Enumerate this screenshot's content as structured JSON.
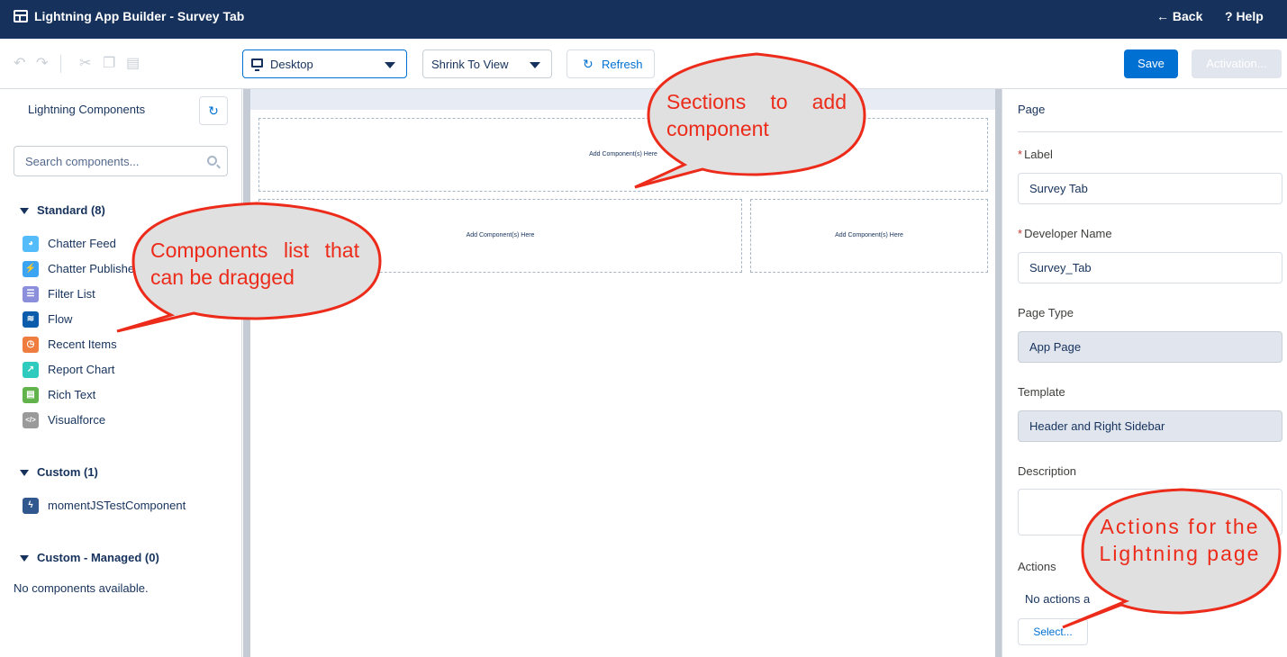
{
  "window": {
    "title": "Lightning App Builder - Survey Tab",
    "back_label": "← Back",
    "help_label": "? Help"
  },
  "toolbar": {
    "device_select": "Desktop",
    "view_select": "Shrink To View",
    "refresh_label": "Refresh",
    "save_label": "Save",
    "activation_label": "Activation..."
  },
  "left_panel": {
    "heading": "Lightning Components",
    "search_placeholder": "Search components...",
    "sections": [
      {
        "title": "Standard (8)",
        "items": [
          {
            "label": "Chatter Feed",
            "icon": "chatter-feed-icon",
            "color": "#55bcfc"
          },
          {
            "label": "Chatter Publisher",
            "icon": "lightning-bolt-icon",
            "color": "#3ba5f3"
          },
          {
            "label": "Filter List",
            "icon": "list-icon",
            "color": "#8b8edb"
          },
          {
            "label": "Flow",
            "icon": "flow-icon",
            "color": "#0b5cab"
          },
          {
            "label": "Recent Items",
            "icon": "clock-icon",
            "color": "#ef7d3f"
          },
          {
            "label": "Report Chart",
            "icon": "chart-icon",
            "color": "#2ecbbe"
          },
          {
            "label": "Rich Text",
            "icon": "rich-text-icon",
            "color": "#62b34b"
          },
          {
            "label": "Visualforce",
            "icon": "code-icon",
            "color": "#9a9a9a"
          }
        ]
      },
      {
        "title": "Custom (1)",
        "items": [
          {
            "label": "momentJSTestComponent",
            "icon": "lightning-bolt-icon",
            "color": "#30588f"
          }
        ]
      },
      {
        "title": "Custom - Managed (0)",
        "empty_text": "No components available."
      }
    ]
  },
  "canvas": {
    "dropzone_label": "Add Component(s) Here"
  },
  "right_panel": {
    "title": "Page",
    "fields": {
      "label": {
        "label": "Label",
        "value": "Survey Tab",
        "required": "*"
      },
      "developer_name": {
        "label": "Developer Name",
        "value": "Survey_Tab",
        "required": "*"
      },
      "page_type": {
        "label": "Page Type",
        "value": "App Page"
      },
      "template": {
        "label": "Template",
        "value": "Header and Right Sidebar"
      },
      "description": {
        "label": "Description",
        "value": ""
      },
      "actions": {
        "label": "Actions",
        "empty_text": "No actions a",
        "select_label": "Select..."
      }
    }
  },
  "callouts": {
    "sections": "Sections to add component",
    "components": "Components list that can be dragged",
    "actions": "Actions for the Lightning page",
    "fill": "#e0e0e0",
    "stroke": "#ec2b1a"
  },
  "colors": {
    "header_bg": "#16325c",
    "brand_blue": "#0070d2"
  }
}
